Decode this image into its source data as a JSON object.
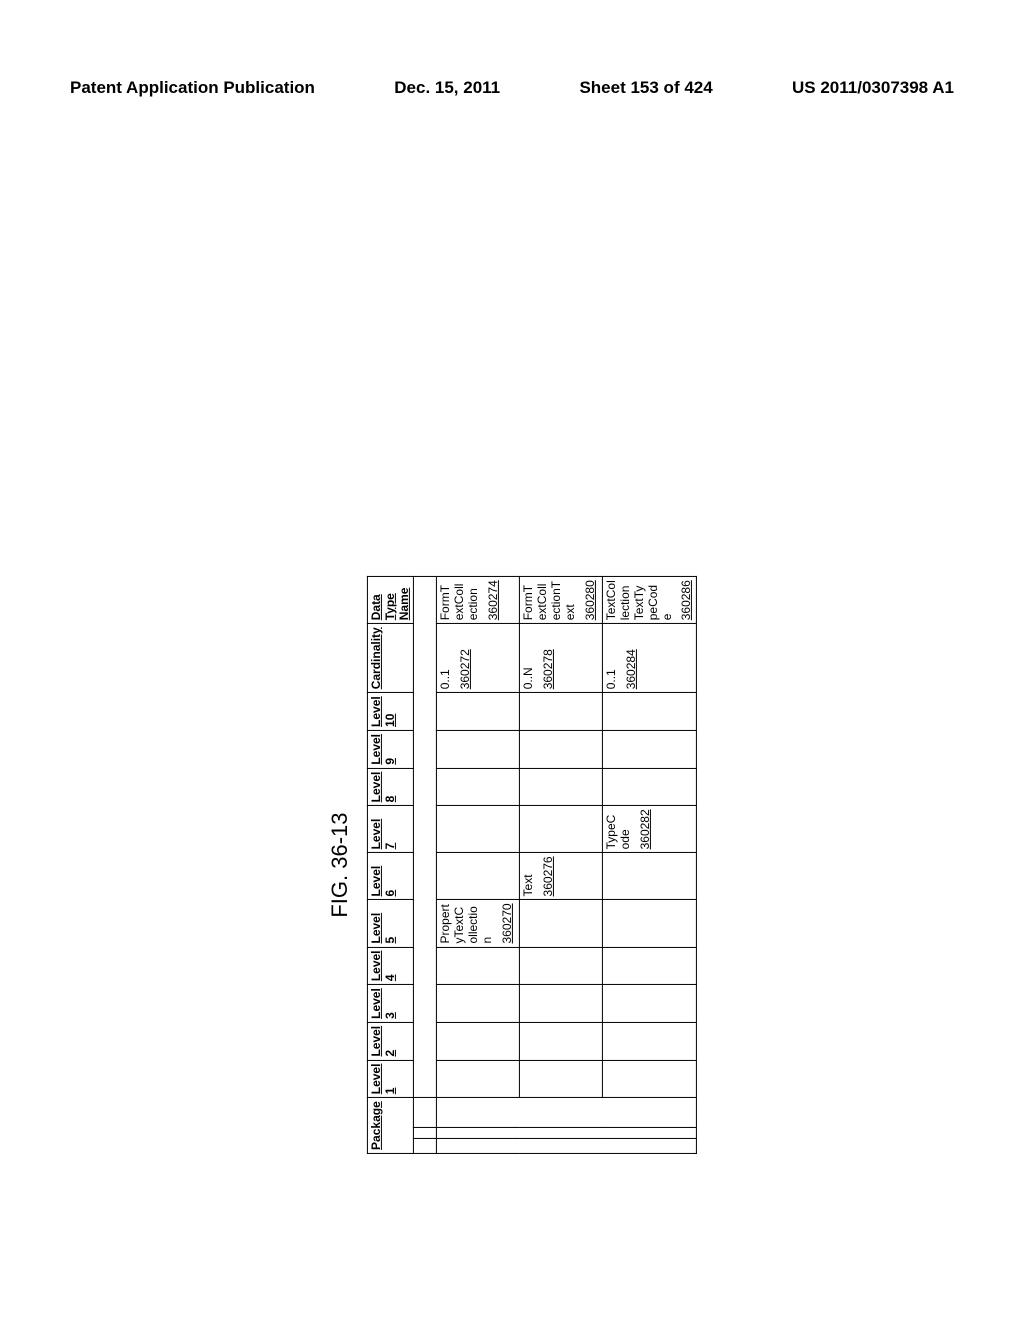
{
  "header": {
    "left": "Patent Application Publication",
    "date": "Dec. 15, 2011",
    "sheet": "Sheet 153 of 424",
    "docket": "US 2011/0307398 A1"
  },
  "figure_label": "FIG. 36-13",
  "columns": {
    "package": "Package",
    "level1": "Level 1",
    "level2": "Level 2",
    "level3": "Level 3",
    "level4": "Level 4",
    "level5": "Level 5",
    "level6": "Level 6",
    "level7": "Level 7",
    "level8": "Level 8",
    "level9": "Level 9",
    "level10": "Level 10",
    "cardinality": "Cardinality",
    "data_type_name": "Data Type Name"
  },
  "rows": [
    {
      "level5": {
        "label": "PropertyTextCollection",
        "ref": "360270"
      },
      "level6": null,
      "level7": null,
      "cardinality": {
        "value": "0..1",
        "ref": "360272"
      },
      "data_type": {
        "label": "FormTextCollection",
        "ref": "360274"
      }
    },
    {
      "level5": null,
      "level6": {
        "label": "Text",
        "ref": "360276"
      },
      "level7": null,
      "cardinality": {
        "value": "0..N",
        "ref": "360278"
      },
      "data_type": {
        "label": "FormTextCollectionText",
        "ref": "360280"
      }
    },
    {
      "level5": null,
      "level6": null,
      "level7": {
        "label": "TypeCode",
        "ref": "360282"
      },
      "cardinality": {
        "value": "0..1",
        "ref": "360284"
      },
      "data_type": {
        "label": "TextCollectionTextTypeCode",
        "ref": "360286"
      }
    }
  ],
  "chart_data": {
    "type": "table",
    "title": "FIG. 36-13",
    "columns": [
      "Package",
      "Level 1",
      "Level 2",
      "Level 3",
      "Level 4",
      "Level 5",
      "Level 6",
      "Level 7",
      "Level 8",
      "Level 9",
      "Level 10",
      "Cardinality",
      "Data Type Name"
    ],
    "rows": [
      {
        "Level 5": "PropertyTextCollection (360270)",
        "Cardinality": "0..1 (360272)",
        "Data Type Name": "FormTextCollection (360274)"
      },
      {
        "Level 6": "Text (360276)",
        "Cardinality": "0..N (360278)",
        "Data Type Name": "FormTextCollectionText (360280)"
      },
      {
        "Level 7": "TypeCode (360282)",
        "Cardinality": "0..1 (360284)",
        "Data Type Name": "TextCollectionTextTypeCode (360286)"
      }
    ]
  }
}
